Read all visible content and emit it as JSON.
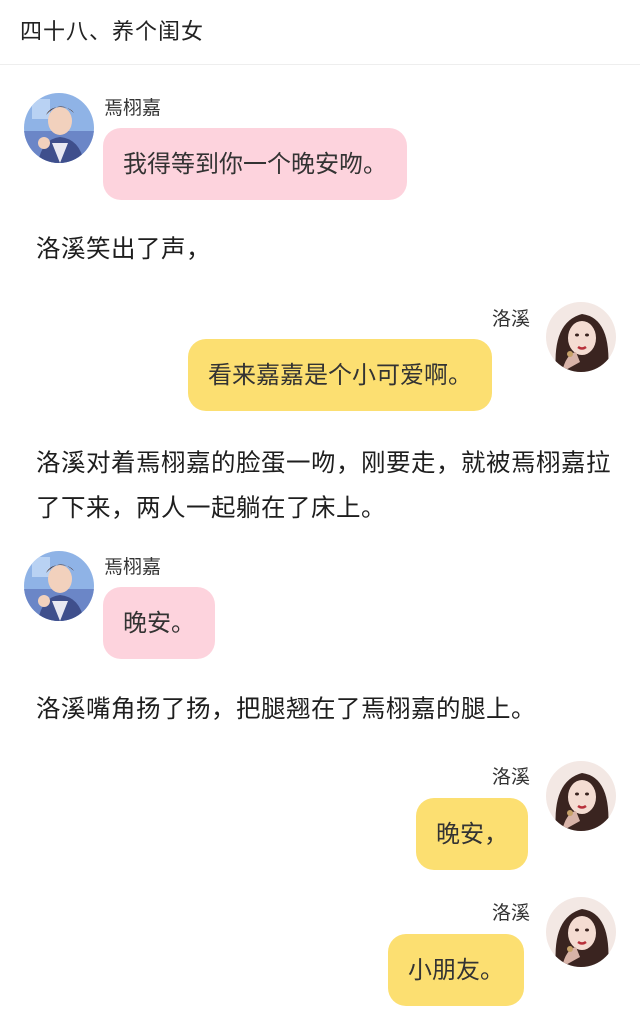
{
  "header": {
    "title": "四十八、养个闺女"
  },
  "chat": {
    "m1": {
      "sender": "焉栩嘉",
      "text": "我得等到你一个晚安吻。",
      "avatar_icon": "boy-avatar-icon"
    },
    "n1": "洛溪笑出了声，",
    "m2": {
      "sender": "洛溪",
      "text": "看来嘉嘉是个小可爱啊。",
      "avatar_icon": "girl-avatar-icon"
    },
    "n2": "洛溪对着焉栩嘉的脸蛋一吻，刚要走，就被焉栩嘉拉了下来，两人一起躺在了床上。",
    "m3": {
      "sender": "焉栩嘉",
      "text": "晚安。",
      "avatar_icon": "boy-avatar-icon"
    },
    "n3": "洛溪嘴角扬了扬，把腿翘在了焉栩嘉的腿上。",
    "m4": {
      "sender": "洛溪",
      "text": "晚安，",
      "avatar_icon": "girl-avatar-icon"
    },
    "m5": {
      "sender": "洛溪",
      "text": "小朋友。",
      "avatar_icon": "girl-avatar-icon"
    }
  },
  "colors": {
    "pink_bubble": "#fdd3dd",
    "yellow_bubble": "#fcdf71"
  }
}
